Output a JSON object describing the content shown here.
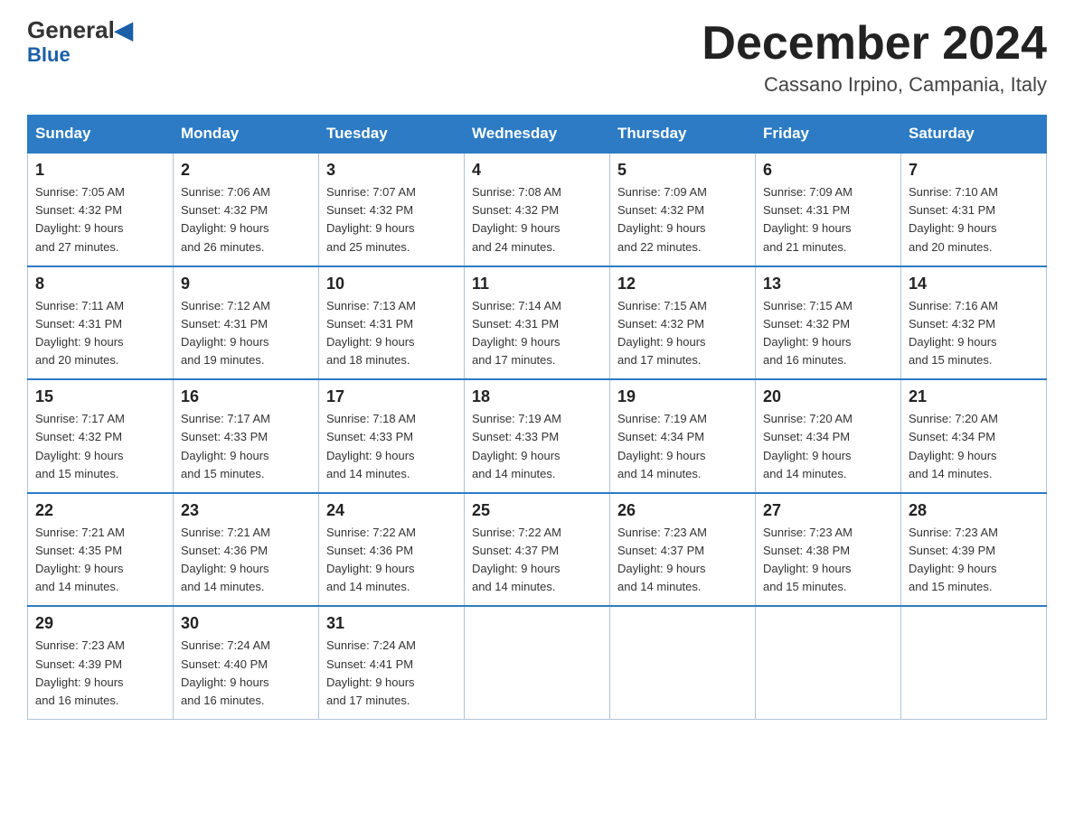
{
  "header": {
    "logo_top": "General",
    "logo_bottom": "Blue",
    "month_title": "December 2024",
    "subtitle": "Cassano Irpino, Campania, Italy"
  },
  "weekdays": [
    "Sunday",
    "Monday",
    "Tuesday",
    "Wednesday",
    "Thursday",
    "Friday",
    "Saturday"
  ],
  "weeks": [
    [
      {
        "day": "1",
        "sunrise": "7:05 AM",
        "sunset": "4:32 PM",
        "daylight": "9 hours and 27 minutes."
      },
      {
        "day": "2",
        "sunrise": "7:06 AM",
        "sunset": "4:32 PM",
        "daylight": "9 hours and 26 minutes."
      },
      {
        "day": "3",
        "sunrise": "7:07 AM",
        "sunset": "4:32 PM",
        "daylight": "9 hours and 25 minutes."
      },
      {
        "day": "4",
        "sunrise": "7:08 AM",
        "sunset": "4:32 PM",
        "daylight": "9 hours and 24 minutes."
      },
      {
        "day": "5",
        "sunrise": "7:09 AM",
        "sunset": "4:32 PM",
        "daylight": "9 hours and 22 minutes."
      },
      {
        "day": "6",
        "sunrise": "7:09 AM",
        "sunset": "4:31 PM",
        "daylight": "9 hours and 21 minutes."
      },
      {
        "day": "7",
        "sunrise": "7:10 AM",
        "sunset": "4:31 PM",
        "daylight": "9 hours and 20 minutes."
      }
    ],
    [
      {
        "day": "8",
        "sunrise": "7:11 AM",
        "sunset": "4:31 PM",
        "daylight": "9 hours and 20 minutes."
      },
      {
        "day": "9",
        "sunrise": "7:12 AM",
        "sunset": "4:31 PM",
        "daylight": "9 hours and 19 minutes."
      },
      {
        "day": "10",
        "sunrise": "7:13 AM",
        "sunset": "4:31 PM",
        "daylight": "9 hours and 18 minutes."
      },
      {
        "day": "11",
        "sunrise": "7:14 AM",
        "sunset": "4:31 PM",
        "daylight": "9 hours and 17 minutes."
      },
      {
        "day": "12",
        "sunrise": "7:15 AM",
        "sunset": "4:32 PM",
        "daylight": "9 hours and 17 minutes."
      },
      {
        "day": "13",
        "sunrise": "7:15 AM",
        "sunset": "4:32 PM",
        "daylight": "9 hours and 16 minutes."
      },
      {
        "day": "14",
        "sunrise": "7:16 AM",
        "sunset": "4:32 PM",
        "daylight": "9 hours and 15 minutes."
      }
    ],
    [
      {
        "day": "15",
        "sunrise": "7:17 AM",
        "sunset": "4:32 PM",
        "daylight": "9 hours and 15 minutes."
      },
      {
        "day": "16",
        "sunrise": "7:17 AM",
        "sunset": "4:33 PM",
        "daylight": "9 hours and 15 minutes."
      },
      {
        "day": "17",
        "sunrise": "7:18 AM",
        "sunset": "4:33 PM",
        "daylight": "9 hours and 14 minutes."
      },
      {
        "day": "18",
        "sunrise": "7:19 AM",
        "sunset": "4:33 PM",
        "daylight": "9 hours and 14 minutes."
      },
      {
        "day": "19",
        "sunrise": "7:19 AM",
        "sunset": "4:34 PM",
        "daylight": "9 hours and 14 minutes."
      },
      {
        "day": "20",
        "sunrise": "7:20 AM",
        "sunset": "4:34 PM",
        "daylight": "9 hours and 14 minutes."
      },
      {
        "day": "21",
        "sunrise": "7:20 AM",
        "sunset": "4:34 PM",
        "daylight": "9 hours and 14 minutes."
      }
    ],
    [
      {
        "day": "22",
        "sunrise": "7:21 AM",
        "sunset": "4:35 PM",
        "daylight": "9 hours and 14 minutes."
      },
      {
        "day": "23",
        "sunrise": "7:21 AM",
        "sunset": "4:36 PM",
        "daylight": "9 hours and 14 minutes."
      },
      {
        "day": "24",
        "sunrise": "7:22 AM",
        "sunset": "4:36 PM",
        "daylight": "9 hours and 14 minutes."
      },
      {
        "day": "25",
        "sunrise": "7:22 AM",
        "sunset": "4:37 PM",
        "daylight": "9 hours and 14 minutes."
      },
      {
        "day": "26",
        "sunrise": "7:23 AM",
        "sunset": "4:37 PM",
        "daylight": "9 hours and 14 minutes."
      },
      {
        "day": "27",
        "sunrise": "7:23 AM",
        "sunset": "4:38 PM",
        "daylight": "9 hours and 15 minutes."
      },
      {
        "day": "28",
        "sunrise": "7:23 AM",
        "sunset": "4:39 PM",
        "daylight": "9 hours and 15 minutes."
      }
    ],
    [
      {
        "day": "29",
        "sunrise": "7:23 AM",
        "sunset": "4:39 PM",
        "daylight": "9 hours and 16 minutes."
      },
      {
        "day": "30",
        "sunrise": "7:24 AM",
        "sunset": "4:40 PM",
        "daylight": "9 hours and 16 minutes."
      },
      {
        "day": "31",
        "sunrise": "7:24 AM",
        "sunset": "4:41 PM",
        "daylight": "9 hours and 17 minutes."
      },
      null,
      null,
      null,
      null
    ]
  ],
  "labels": {
    "sunrise": "Sunrise:",
    "sunset": "Sunset:",
    "daylight": "Daylight:"
  }
}
